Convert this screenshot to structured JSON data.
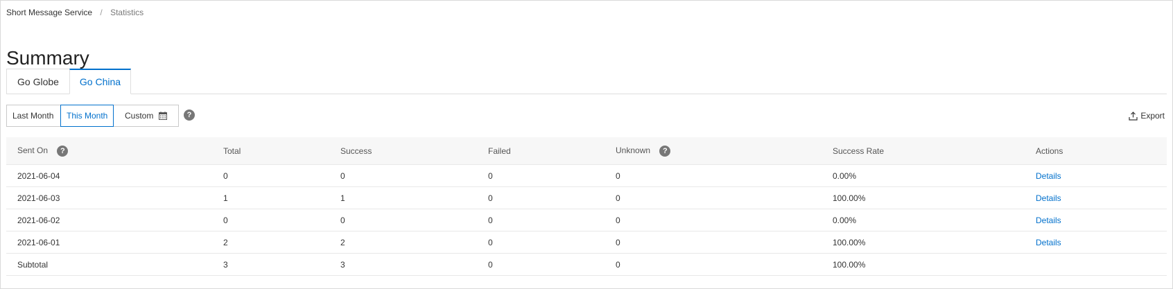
{
  "breadcrumb": {
    "root": "Short Message Service",
    "separator": "/",
    "current": "Statistics"
  },
  "page_title": "Summary",
  "tabs": [
    {
      "label": "Go Globe",
      "active": false
    },
    {
      "label": "Go China",
      "active": true
    }
  ],
  "range": {
    "last_month": "Last Month",
    "this_month": "This Month",
    "custom": "Custom",
    "selected": "This Month",
    "help": "?"
  },
  "export_label": "Export",
  "table": {
    "headers": {
      "sent_on": "Sent On",
      "total": "Total",
      "success": "Success",
      "failed": "Failed",
      "unknown": "Unknown",
      "success_rate": "Success Rate",
      "actions": "Actions"
    },
    "help": "?",
    "rows": [
      {
        "sent_on": "2021-06-04",
        "total": "0",
        "success": "0",
        "failed": "0",
        "unknown": "0",
        "success_rate": "0.00%",
        "action": "Details"
      },
      {
        "sent_on": "2021-06-03",
        "total": "1",
        "success": "1",
        "failed": "0",
        "unknown": "0",
        "success_rate": "100.00%",
        "action": "Details"
      },
      {
        "sent_on": "2021-06-02",
        "total": "0",
        "success": "0",
        "failed": "0",
        "unknown": "0",
        "success_rate": "0.00%",
        "action": "Details"
      },
      {
        "sent_on": "2021-06-01",
        "total": "2",
        "success": "2",
        "failed": "0",
        "unknown": "0",
        "success_rate": "100.00%",
        "action": "Details"
      }
    ],
    "subtotal": {
      "sent_on": "Subtotal",
      "total": "3",
      "success": "3",
      "failed": "0",
      "unknown": "0",
      "success_rate": "100.00%",
      "action": ""
    }
  },
  "colors": {
    "accent": "#0070cc",
    "border": "#d9d9d9",
    "header_bg": "#f7f7f7",
    "help_icon": "#777777"
  },
  "icons": {
    "calendar": "calendar-icon",
    "help": "help-icon",
    "export": "export-icon"
  }
}
